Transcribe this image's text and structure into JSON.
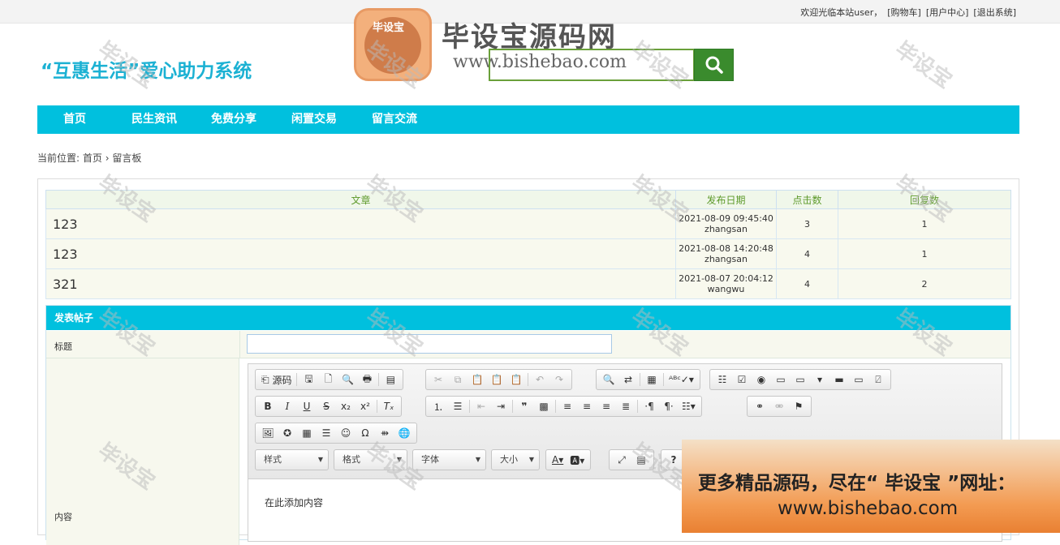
{
  "header": {
    "links": [
      "欢迎光临本站user，",
      "[购物车]",
      "[用户中心]",
      "[退出系统]"
    ]
  },
  "site": {
    "title": "“互惠生活”爱心助力系统"
  },
  "logo": {
    "badge_text": "毕设宝",
    "name": "毕设宝源码网",
    "url": "www.bishebao.com"
  },
  "nav": {
    "items": [
      "首页",
      "民生资讯",
      "免费分享",
      "闲置交易",
      "留言交流"
    ]
  },
  "breadcrumb": {
    "prefix": "当前位置:",
    "home": "首页",
    "sep": "›",
    "current": "留言板"
  },
  "table": {
    "headers": [
      "文章",
      "发布日期",
      "点击数",
      "回复数"
    ],
    "rows": [
      {
        "title": "123",
        "date": "2021-08-09 09:45:40",
        "author": "zhangsan",
        "clicks": "3",
        "replies": "1"
      },
      {
        "title": "123",
        "date": "2021-08-08 14:20:48",
        "author": "zhangsan",
        "clicks": "4",
        "replies": "1"
      },
      {
        "title": "321",
        "date": "2021-08-07 20:04:12",
        "author": "wangwu",
        "clicks": "4",
        "replies": "2"
      }
    ]
  },
  "form": {
    "header": "发表帖子",
    "title_label": "标题",
    "content_label": "内容",
    "content_placeholder": "在此添加内容"
  },
  "editor": {
    "source_label": "源码",
    "style_label": "样式",
    "format_label": "格式",
    "font_label": "字体",
    "size_label": "大小"
  },
  "watermark": {
    "text": "毕设宝"
  },
  "ad": {
    "line1": "更多精品源码，尽在“ 毕设宝 ”网址：",
    "line2": "www.bishebao.com"
  },
  "colors": {
    "accent": "#00c0de",
    "title": "#1bb1d3",
    "search": "#3a8b2d"
  }
}
